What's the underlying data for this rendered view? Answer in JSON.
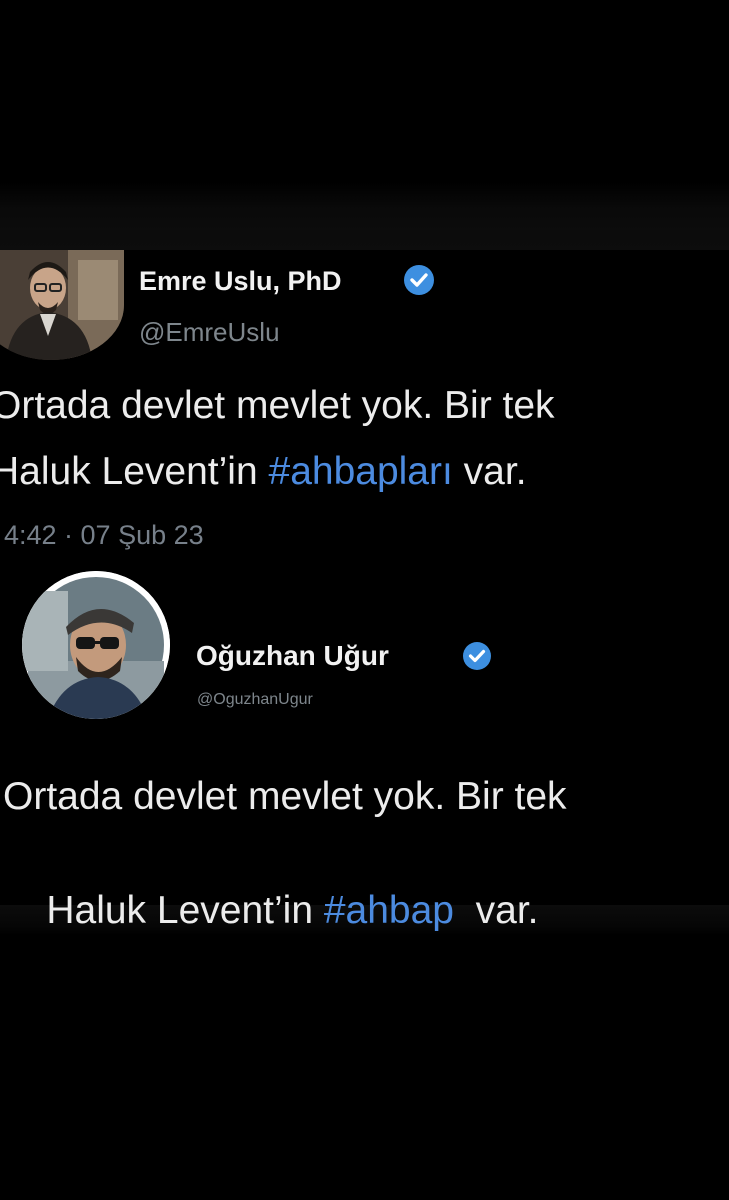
{
  "tweet1": {
    "name": "Emre Uslu, PhD",
    "handle": "@EmreUslu",
    "line1": "Ortada devlet mevlet yok. Bir tek",
    "line2_pre": "Haluk Levent’in ",
    "line2_hashtag": "#ahbapları",
    "line2_post": " var.",
    "timestamp": "4:42 · 07 Şub 23",
    "avatar_icon": "person-avatar",
    "verified_icon": "verified-badge-icon"
  },
  "tweet2": {
    "name": "Oğuzhan Uğur",
    "handle": "@OguzhanUgur",
    "line1": "Ortada devlet mevlet yok. Bir tek",
    "line2_pre": "Haluk Levent’in ",
    "line2_hashtag": "#ahbap",
    "line2_post": "  var.",
    "avatar_icon": "person-avatar",
    "verified_icon": "verified-badge-icon"
  },
  "colors": {
    "background": "#000000",
    "text": "#ececec",
    "hashtag": "#4c8be0",
    "handle": "#7e868c",
    "verified": "#3d8fe0"
  }
}
